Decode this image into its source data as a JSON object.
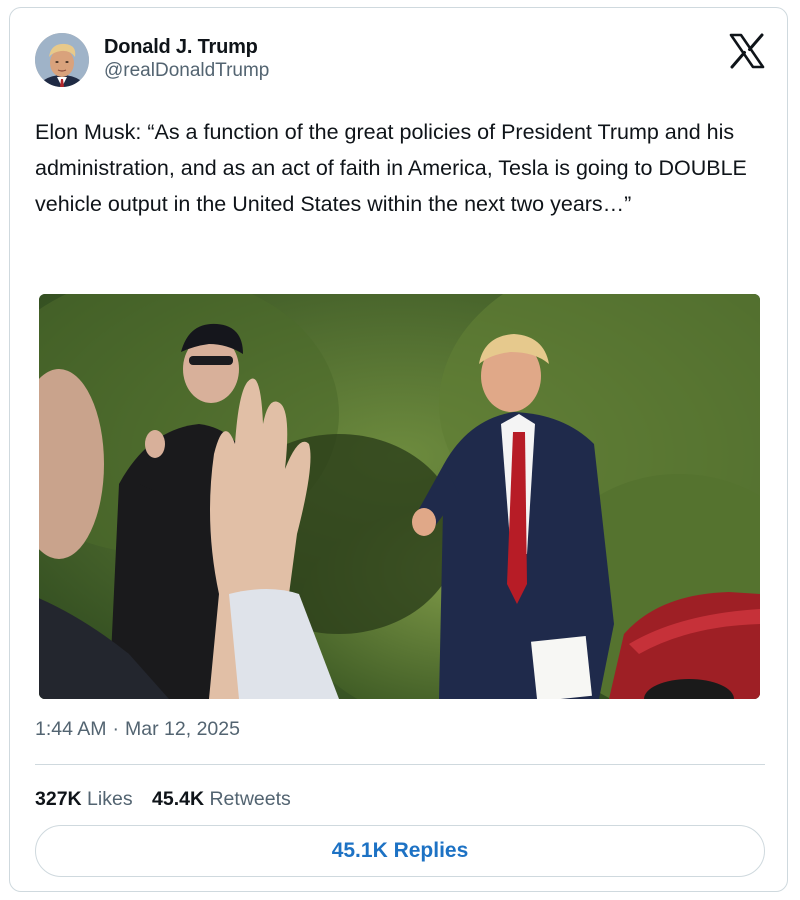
{
  "author": {
    "name": "Donald J. Trump",
    "handle": "@realDonaldTrump",
    "avatar_icon": "profile-photo"
  },
  "brand": {
    "logo_icon": "x-logo-icon"
  },
  "tweet": {
    "text": "Elon Musk: “As a function of the great policies of President Trump and his administration, and as an act of faith in America, Tesla is going to DOUBLE vehicle output in the United States within the next two years…”",
    "media_icon": "photo"
  },
  "meta": {
    "time": "1:44 AM",
    "separator": "·",
    "date": "Mar 12, 2025"
  },
  "stats": {
    "likes_count": "327K",
    "likes_label": "Likes",
    "retweets_count": "45.4K",
    "retweets_label": "Retweets"
  },
  "replies_button": {
    "label": "45.1K Replies"
  },
  "colors": {
    "text_primary": "#0f1419",
    "text_secondary": "#536471",
    "border": "#cfd9de",
    "accent": "#1d72c4"
  }
}
